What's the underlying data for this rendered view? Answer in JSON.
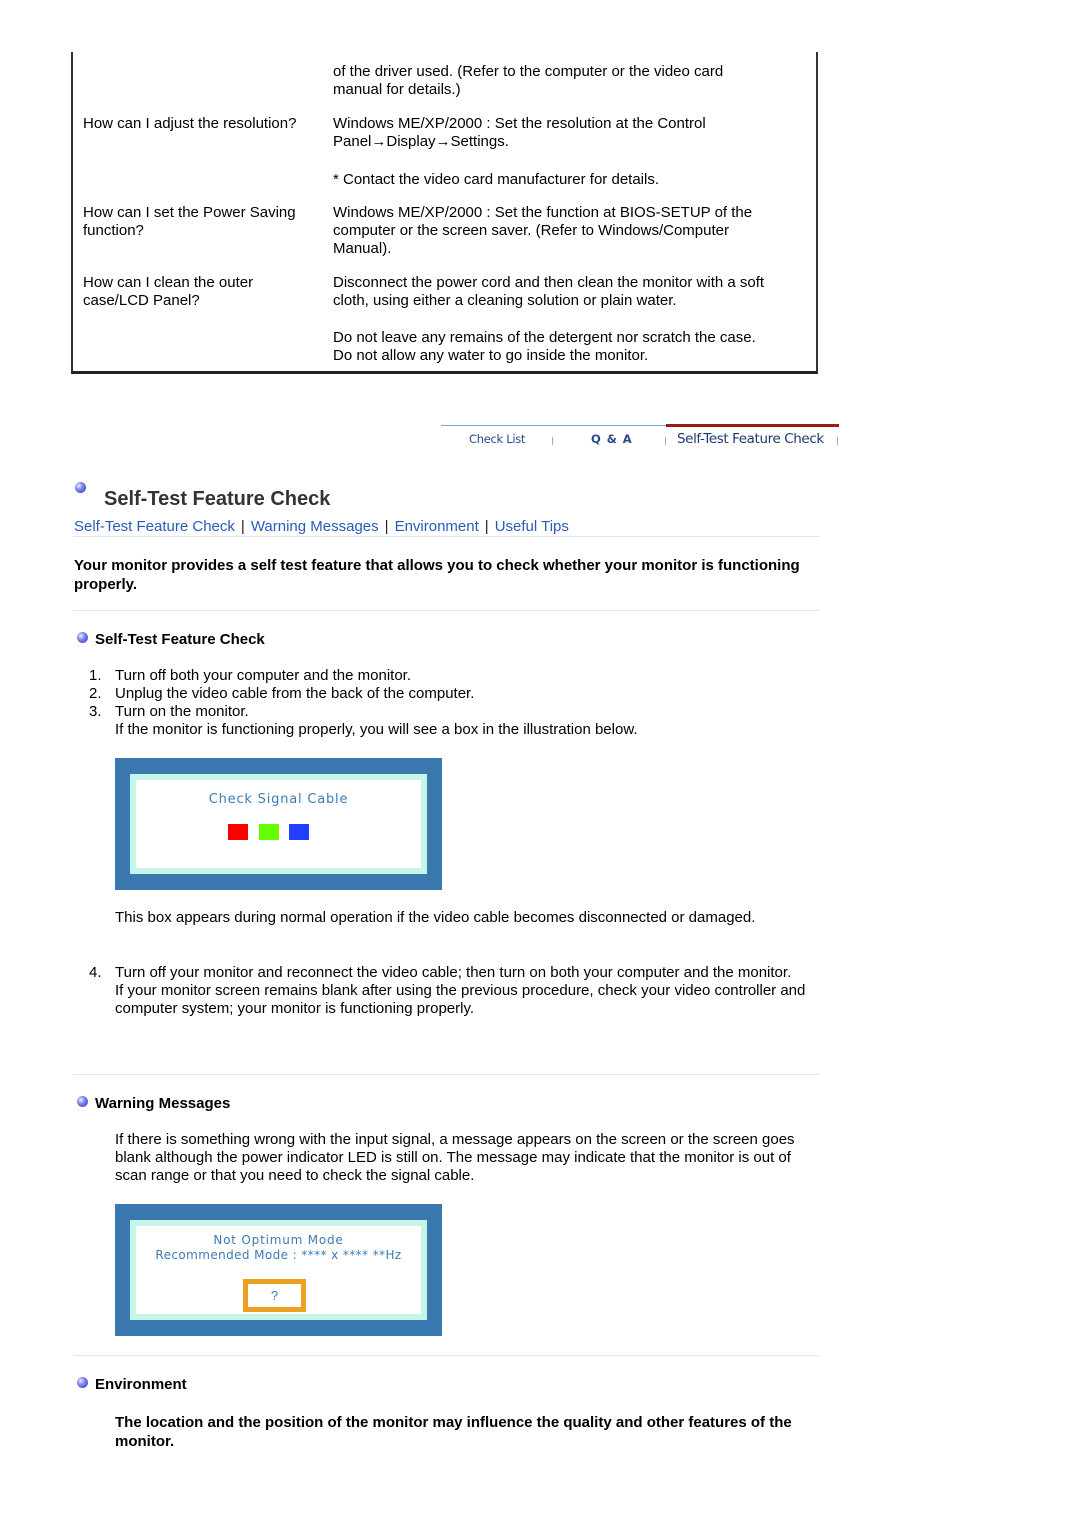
{
  "faq": [
    {
      "question": "",
      "answer": [
        "of the driver used. (Refer to the computer or the video card",
        "manual for details.)"
      ]
    },
    {
      "question": "How can I adjust the resolution?",
      "answer": [
        "Windows ME/XP/2000 : Set the resolution at the Control",
        "Panel→Display→Settings."
      ]
    },
    {
      "question": "",
      "answer": [
        "* Contact the video card manufacturer for details."
      ]
    },
    {
      "question": "How can I set the Power Saving function?",
      "question_lines": [
        "How can I set the Power Saving",
        "function?"
      ],
      "answer": [
        "Windows ME/XP/2000 : Set the function at BIOS-SETUP of the",
        "computer or the screen saver. (Refer to Windows/Computer",
        "Manual)."
      ]
    },
    {
      "question": "How can I clean the outer case/LCD Panel?",
      "question_lines": [
        "How can I clean the outer",
        "case/LCD Panel?"
      ],
      "answer": [
        "Disconnect the power cord and then clean the monitor with a soft",
        "cloth, using either a cleaning solution or plain water."
      ]
    },
    {
      "question": "",
      "answer": [
        "Do not leave any remains of the detergent nor scratch the case.",
        "Do not allow any water to go inside the monitor."
      ]
    }
  ],
  "tabs": [
    {
      "label": "Check List",
      "active": false
    },
    {
      "label": "Q & A",
      "active": false
    },
    {
      "label": "Self-Test Feature Check",
      "active": true
    }
  ],
  "page": {
    "title": "Self-Test Feature Check",
    "subnav": [
      "Self-Test Feature Check",
      "Warning Messages",
      "Environment",
      "Useful Tips"
    ],
    "subnav_separator": "|",
    "intro": "Your monitor provides a self test feature that allows you to check whether your monitor is functioning properly."
  },
  "self_test": {
    "heading": "Self-Test Feature Check",
    "steps": [
      {
        "num": "1.",
        "text": "Turn off both your computer and the monitor."
      },
      {
        "num": "2.",
        "text": "Unplug the video cable from the back of the computer."
      },
      {
        "num": "3.",
        "text": "Turn on the monitor.",
        "note": "If the monitor is functioning properly, you will see a box in the illustration below."
      }
    ],
    "osd_message": "Check Signal Cable",
    "osd_colors": {
      "red": "#ff0000",
      "green": "#66ff00",
      "blue": "#2040ff"
    },
    "after_box": "This box appears during normal operation if the video cable becomes disconnected or damaged.",
    "step4": {
      "num": "4.",
      "text": "Turn off your monitor and reconnect the video cable; then turn on both your computer and the monitor.",
      "note": "If your monitor screen remains blank after using the previous procedure, check your video controller and computer system; your monitor is functioning properly."
    }
  },
  "warning": {
    "heading": "Warning Messages",
    "text": "If there is something wrong with the input signal, a message appears on the screen or the screen goes blank although the power indicator LED is still on. The message may indicate that the monitor is out of scan range or that you need to check the signal cable.",
    "osd_line1": "Not Optimum Mode",
    "osd_line2": "Recommended Mode : **** x ****  **Hz",
    "osd_button": "?"
  },
  "environment": {
    "heading": "Environment",
    "text": "The location and the position of the monitor may influence the quality and other features of the monitor."
  },
  "colors": {
    "link": "#2a5ab8",
    "osd_frame": "#3a78b0",
    "osd_inner_border": "#c6f5ea",
    "active_tab_bar": "#9b1b1b"
  }
}
